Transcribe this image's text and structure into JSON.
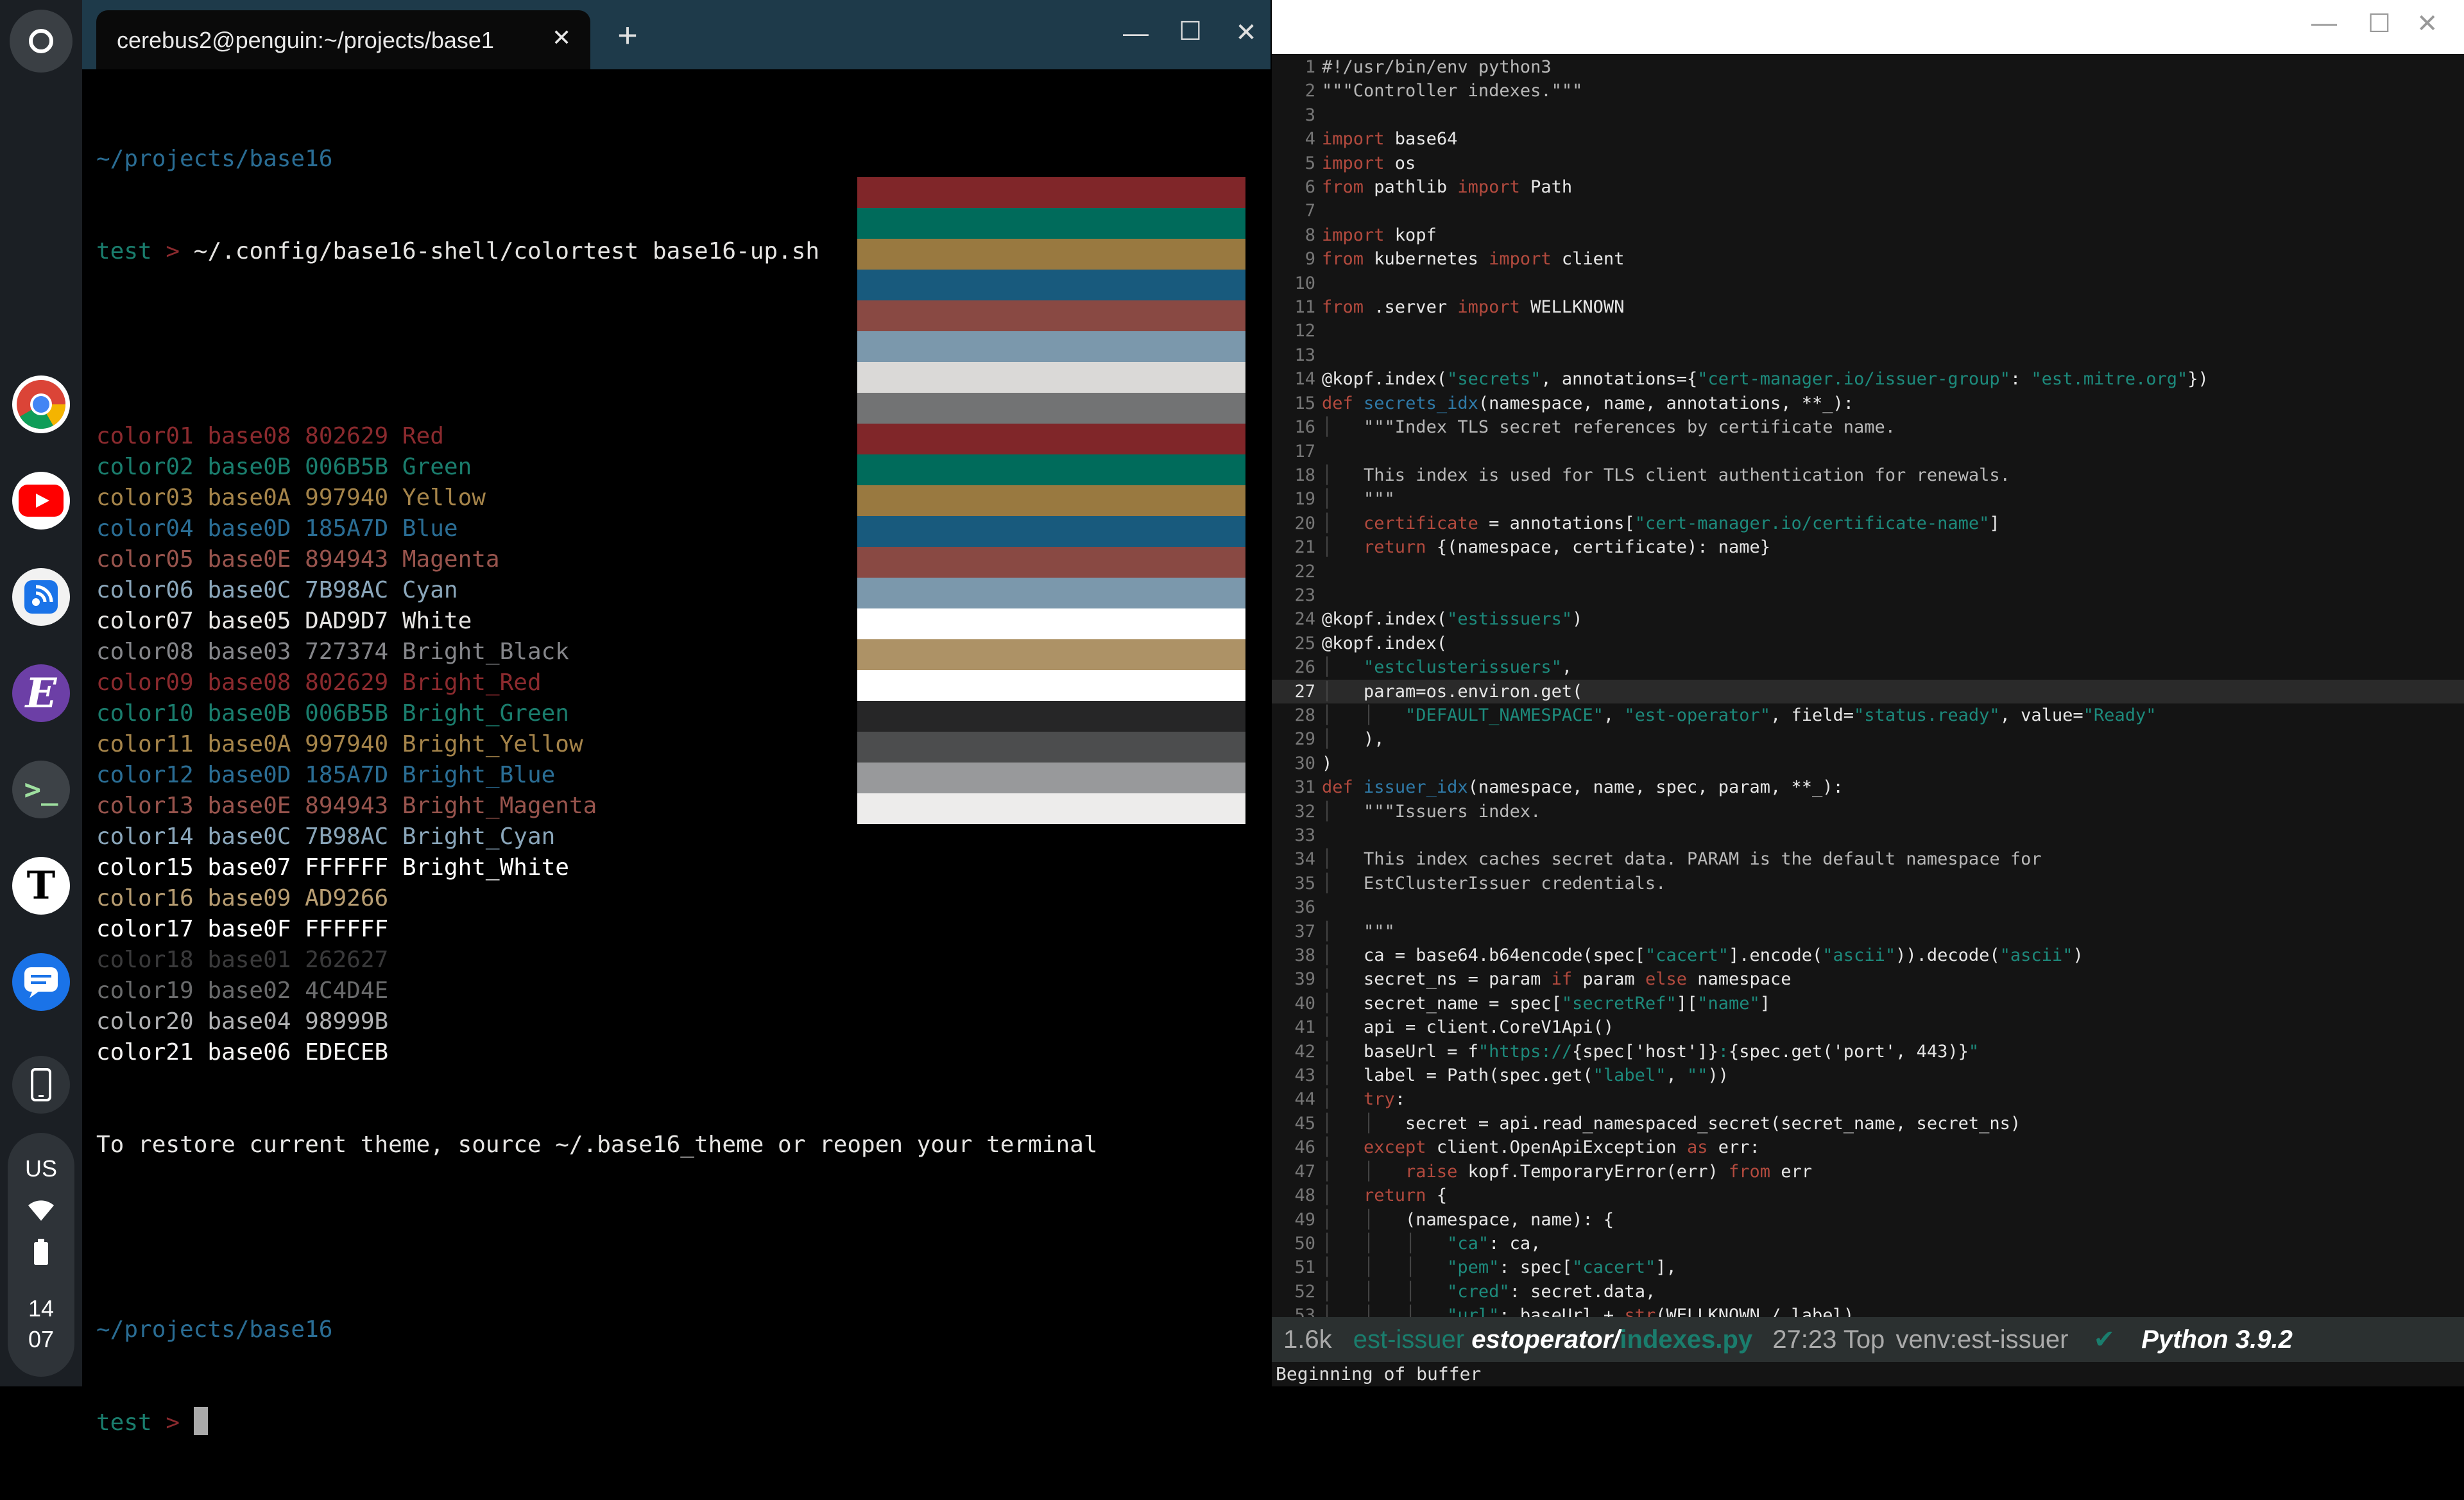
{
  "shelf": {
    "keyboard_layout": "US",
    "time_hour": "14",
    "time_min": "07",
    "apps": [
      "chrome-icon",
      "youtube-icon",
      "podcast-icon",
      "emacs-icon",
      "terminal-icon",
      "nytimes-icon",
      "messages-icon",
      "phone-icon"
    ]
  },
  "terminal": {
    "tab_title": "cerebus2@penguin:~/projects/base1",
    "new_tab": "+",
    "minimize": "—",
    "maximize": "☐",
    "close": "✕",
    "prompt_dir": "~/projects/base16",
    "prompt_name": "test",
    "prompt_arrow": ">",
    "command": "~/.config/base16-shell/colortest base16-up.sh",
    "colors": [
      {
        "name": "color01",
        "base": "base08",
        "hex": "802629",
        "label": "Red",
        "text": "#8b2a2e",
        "bar": "#802629"
      },
      {
        "name": "color02",
        "base": "base0B",
        "hex": "006B5B",
        "label": "Green",
        "text": "#1a7d6d",
        "bar": "#006B5B"
      },
      {
        "name": "color03",
        "base": "base0A",
        "hex": "997940",
        "label": "Yellow",
        "text": "#a5844a",
        "bar": "#997940"
      },
      {
        "name": "color04",
        "base": "base0D",
        "hex": "185A7D",
        "label": "Blue",
        "text": "#2a6d94",
        "bar": "#185A7D"
      },
      {
        "name": "color05",
        "base": "base0E",
        "hex": "894943",
        "label": "Magenta",
        "text": "#98544d",
        "bar": "#894943"
      },
      {
        "name": "color06",
        "base": "base0C",
        "hex": "7B98AC",
        "label": "Cyan",
        "text": "#8aa6ba",
        "bar": "#7B98AC"
      },
      {
        "name": "color07",
        "base": "base05",
        "hex": "DAD9D7",
        "label": "White",
        "text": "#e6e5e3",
        "bar": "#DAD9D7"
      },
      {
        "name": "color08",
        "base": "base03",
        "hex": "727374",
        "label": "Bright_Black",
        "text": "#85868a",
        "bar": "#727374"
      },
      {
        "name": "color09",
        "base": "base08",
        "hex": "802629",
        "label": "Bright_Red",
        "text": "#8b2a2e",
        "bar": "#802629"
      },
      {
        "name": "color10",
        "base": "base0B",
        "hex": "006B5B",
        "label": "Bright_Green",
        "text": "#1a7d6d",
        "bar": "#006B5B"
      },
      {
        "name": "color11",
        "base": "base0A",
        "hex": "997940",
        "label": "Bright_Yellow",
        "text": "#a5844a",
        "bar": "#997940"
      },
      {
        "name": "color12",
        "base": "base0D",
        "hex": "185A7D",
        "label": "Bright_Blue",
        "text": "#2a6d94",
        "bar": "#185A7D"
      },
      {
        "name": "color13",
        "base": "base0E",
        "hex": "894943",
        "label": "Bright_Magenta",
        "text": "#98544d",
        "bar": "#894943"
      },
      {
        "name": "color14",
        "base": "base0C",
        "hex": "7B98AC",
        "label": "Bright_Cyan",
        "text": "#8aa6ba",
        "bar": "#7B98AC"
      },
      {
        "name": "color15",
        "base": "base07",
        "hex": "FFFFFF",
        "label": "Bright_White",
        "text": "#ffffff",
        "bar": "#FFFFFF"
      },
      {
        "name": "color16",
        "base": "base09",
        "hex": "AD9266",
        "label": "",
        "text": "#b79d72",
        "bar": "#AD9266"
      },
      {
        "name": "color17",
        "base": "base0F",
        "hex": "FFFFFF",
        "label": "",
        "text": "#ffffff",
        "bar": "#FFFFFF"
      },
      {
        "name": "color18",
        "base": "base01",
        "hex": "262627",
        "label": "",
        "text": "#3a3a3b",
        "bar": "#262627"
      },
      {
        "name": "color19",
        "base": "base02",
        "hex": "4C4D4E",
        "label": "",
        "text": "#6a6b6c",
        "bar": "#4C4D4E"
      },
      {
        "name": "color20",
        "base": "base04",
        "hex": "98999B",
        "label": "",
        "text": "#b0b1b3",
        "bar": "#98999B"
      },
      {
        "name": "color21",
        "base": "base06",
        "hex": "EDECEB",
        "label": "",
        "text": "#f3f2f1",
        "bar": "#EDECEB"
      }
    ],
    "restore_msg": "To restore current theme, source ~/.base16_theme or reopen your terminal"
  },
  "editor": {
    "modeline": {
      "size": "1.6k",
      "project": "est-issuer",
      "dir": "estoperator/",
      "file": "indexes.py",
      "pos": "27:23",
      "pct": "Top",
      "venv": "venv:est-issuer",
      "check": "✔",
      "lang": "Python 3.9.2"
    },
    "echo": "Beginning of buffer",
    "lines": [
      [
        [
          "co",
          "#!/usr/bin/env python3"
        ]
      ],
      [
        [
          "co",
          "\"\"\"Controller indexes.\"\"\""
        ]
      ],
      [],
      [
        [
          "kw",
          "import"
        ],
        [
          "tx",
          " base64"
        ]
      ],
      [
        [
          "kw",
          "import"
        ],
        [
          "tx",
          " os"
        ]
      ],
      [
        [
          "kw",
          "from"
        ],
        [
          "tx",
          " pathlib "
        ],
        [
          "kw",
          "import"
        ],
        [
          "tx",
          " Path"
        ]
      ],
      [],
      [
        [
          "kw",
          "import"
        ],
        [
          "tx",
          " kopf"
        ]
      ],
      [
        [
          "kw",
          "from"
        ],
        [
          "tx",
          " kubernetes "
        ],
        [
          "kw",
          "import"
        ],
        [
          "tx",
          " client"
        ]
      ],
      [],
      [
        [
          "kw",
          "from"
        ],
        [
          "tx",
          " .server "
        ],
        [
          "kw",
          "import"
        ],
        [
          "tx",
          " WELLKNOWN"
        ]
      ],
      [],
      [],
      [
        [
          "tx",
          "@kopf.index("
        ],
        [
          "st",
          "\"secrets\""
        ],
        [
          "tx",
          ", annotations={"
        ],
        [
          "st",
          "\"cert-manager.io/issuer-group\""
        ],
        [
          "tx",
          ": "
        ],
        [
          "st",
          "\"est.mitre.org\""
        ],
        [
          "tx",
          "})"
        ]
      ],
      [
        [
          "kw",
          "def"
        ],
        [
          "tx",
          " "
        ],
        [
          "fn",
          "secrets_idx"
        ],
        [
          "tx",
          "(namespace, name, annotations, **_):"
        ]
      ],
      [
        [
          "ind",
          "│   "
        ],
        [
          "co",
          "\"\"\"Index TLS secret references by certificate name."
        ]
      ],
      [],
      [
        [
          "ind",
          "│   "
        ],
        [
          "co",
          "This index is used for TLS client authentication for renewals."
        ]
      ],
      [
        [
          "ind",
          "│   "
        ],
        [
          "co",
          "\"\"\""
        ]
      ],
      [
        [
          "ind",
          "│   "
        ],
        [
          "kw",
          "certificate"
        ],
        [
          "tx",
          " = annotations["
        ],
        [
          "st",
          "\"cert-manager.io/certificate-name\""
        ],
        [
          "tx",
          "]"
        ]
      ],
      [
        [
          "ind",
          "│   "
        ],
        [
          "kw",
          "return"
        ],
        [
          "tx",
          " {(namespace, certificate): name}"
        ]
      ],
      [],
      [],
      [
        [
          "tx",
          "@kopf.index("
        ],
        [
          "st",
          "\"estissuers\""
        ],
        [
          "tx",
          ")"
        ]
      ],
      [
        [
          "tx",
          "@kopf.index("
        ]
      ],
      [
        [
          "ind",
          "│   "
        ],
        [
          "st",
          "\"estclusterissuers\""
        ],
        [
          "tx",
          ","
        ]
      ],
      [
        [
          "ind",
          "│   "
        ],
        [
          "tx",
          "param=os.environ.get("
        ]
      ],
      [
        [
          "ind",
          "│   │   "
        ],
        [
          "st",
          "\"DEFAULT_NAMESPACE\""
        ],
        [
          "tx",
          ", "
        ],
        [
          "st",
          "\"est-operator\""
        ],
        [
          "tx",
          ", field="
        ],
        [
          "st",
          "\"status.ready\""
        ],
        [
          "tx",
          ", value="
        ],
        [
          "st",
          "\"Ready\""
        ]
      ],
      [
        [
          "ind",
          "│   "
        ],
        [
          "tx",
          "),"
        ]
      ],
      [
        [
          "tx",
          ")"
        ]
      ],
      [
        [
          "kw",
          "def"
        ],
        [
          "tx",
          " "
        ],
        [
          "fn",
          "issuer_idx"
        ],
        [
          "tx",
          "(namespace, name, spec, param, **_):"
        ]
      ],
      [
        [
          "ind",
          "│   "
        ],
        [
          "co",
          "\"\"\"Issuers index."
        ]
      ],
      [],
      [
        [
          "ind",
          "│   "
        ],
        [
          "co",
          "This index caches secret data. PARAM is the default namespace for"
        ]
      ],
      [
        [
          "ind",
          "│   "
        ],
        [
          "co",
          "EstClusterIssuer credentials."
        ]
      ],
      [],
      [
        [
          "ind",
          "│   "
        ],
        [
          "co",
          "\"\"\""
        ]
      ],
      [
        [
          "ind",
          "│   "
        ],
        [
          "tx",
          "ca = base64.b64encode(spec["
        ],
        [
          "st",
          "\"cacert\""
        ],
        [
          "tx",
          "].encode("
        ],
        [
          "st",
          "\"ascii\""
        ],
        [
          "tx",
          ")).decode("
        ],
        [
          "st",
          "\"ascii\""
        ],
        [
          "tx",
          ")"
        ]
      ],
      [
        [
          "ind",
          "│   "
        ],
        [
          "tx",
          "secret_ns = param "
        ],
        [
          "kw",
          "if"
        ],
        [
          "tx",
          " param "
        ],
        [
          "kw",
          "else"
        ],
        [
          "tx",
          " namespace"
        ]
      ],
      [
        [
          "ind",
          "│   "
        ],
        [
          "tx",
          "secret_name = spec["
        ],
        [
          "st",
          "\"secretRef\""
        ],
        [
          "tx",
          "]["
        ],
        [
          "st",
          "\"name\""
        ],
        [
          "tx",
          "]"
        ]
      ],
      [
        [
          "ind",
          "│   "
        ],
        [
          "tx",
          "api = client.CoreV1Api()"
        ]
      ],
      [
        [
          "ind",
          "│   "
        ],
        [
          "tx",
          "baseUrl = f"
        ],
        [
          "st",
          "\"https://"
        ],
        [
          "tx",
          "{spec['host']}"
        ],
        [
          "st",
          ":"
        ],
        [
          "tx",
          "{spec.get('port', 443)}"
        ],
        [
          "st",
          "\""
        ]
      ],
      [
        [
          "ind",
          "│   "
        ],
        [
          "tx",
          "label = Path(spec.get("
        ],
        [
          "st",
          "\"label\""
        ],
        [
          "tx",
          ", "
        ],
        [
          "st",
          "\"\""
        ],
        [
          "tx",
          "))"
        ]
      ],
      [
        [
          "ind",
          "│   "
        ],
        [
          "kw",
          "try"
        ],
        [
          "tx",
          ":"
        ]
      ],
      [
        [
          "ind",
          "│   │   "
        ],
        [
          "tx",
          "secret = api.read_namespaced_secret(secret_name, secret_ns)"
        ]
      ],
      [
        [
          "ind",
          "│   "
        ],
        [
          "kw",
          "except"
        ],
        [
          "tx",
          " client.OpenApiException "
        ],
        [
          "kw",
          "as"
        ],
        [
          "tx",
          " err:"
        ]
      ],
      [
        [
          "ind",
          "│   │   "
        ],
        [
          "kw",
          "raise"
        ],
        [
          "tx",
          " kopf.TemporaryError(err) "
        ],
        [
          "kw",
          "from"
        ],
        [
          "tx",
          " err"
        ]
      ],
      [
        [
          "ind",
          "│   "
        ],
        [
          "kw",
          "return"
        ],
        [
          "tx",
          " {"
        ]
      ],
      [
        [
          "ind",
          "│   │   "
        ],
        [
          "tx",
          "(namespace, name): {"
        ]
      ],
      [
        [
          "ind",
          "│   │   │   "
        ],
        [
          "st",
          "\"ca\""
        ],
        [
          "tx",
          ": ca,"
        ]
      ],
      [
        [
          "ind",
          "│   │   │   "
        ],
        [
          "st",
          "\"pem\""
        ],
        [
          "tx",
          ": spec["
        ],
        [
          "st",
          "\"cacert\""
        ],
        [
          "tx",
          "],"
        ]
      ],
      [
        [
          "ind",
          "│   │   │   "
        ],
        [
          "st",
          "\"cred\""
        ],
        [
          "tx",
          ": secret.data,"
        ]
      ],
      [
        [
          "ind",
          "│   │   │   "
        ],
        [
          "st",
          "\"url\""
        ],
        [
          "tx",
          ": baseUrl + "
        ],
        [
          "kw",
          "str"
        ],
        [
          "tx",
          "(WELLKNOWN / label),"
        ]
      ]
    ],
    "current_line": 27
  }
}
